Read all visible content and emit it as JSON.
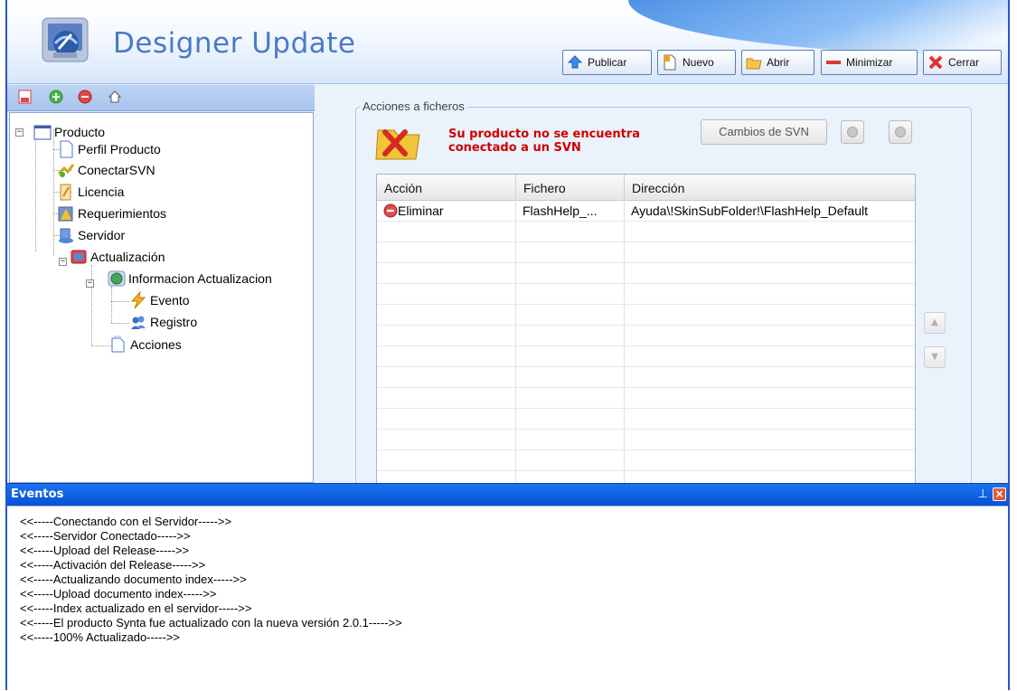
{
  "app": {
    "title": "Designer Update"
  },
  "toolbar": {
    "buttons": [
      {
        "label": "Publicar",
        "icon": "publish-icon"
      },
      {
        "label": "Nuevo",
        "icon": "new-document-icon"
      },
      {
        "label": "Abrir",
        "icon": "open-folder-icon"
      },
      {
        "label": "Minimizar",
        "icon": "minimize-icon"
      },
      {
        "label": "Cerrar",
        "icon": "close-x-icon"
      }
    ]
  },
  "tree": {
    "root": "Producto",
    "items": [
      "Perfil Producto",
      "ConectarSVN",
      "Licencia",
      "Requerimientos",
      "Servidor",
      "Actualización",
      "Informacion Actualizacion",
      "Evento",
      "Registro",
      "Acciones"
    ]
  },
  "main": {
    "group_title": "Acciones a ficheros",
    "warning": "Su producto no se encuentra conectado a un SVN",
    "svn_button": "Cambios de SVN",
    "columns": [
      "Acción",
      "Fichero",
      "Dirección"
    ],
    "rows": [
      {
        "accion": "Eliminar",
        "fichero": "FlashHelp_...",
        "direccion": "Ayuda\\!SkinSubFolder!\\FlashHelp_Default"
      }
    ]
  },
  "events": {
    "title": "Eventos",
    "lines": [
      "<<-----Conectando con el Servidor----->>",
      "<<-----Servidor Conectado----->>",
      "<<-----Upload del Release----->>",
      "<<-----Activación del Release----->>",
      "<<-----Actualizando documento index----->>",
      "<<-----Upload documento index----->>",
      "<<-----Index actualizado en el servidor----->>",
      "<<-----El producto Synta fue actualizado con la nueva versión 2.0.1----->>",
      "<<-----100% Actualizado----->>"
    ]
  },
  "colors": {
    "accent": "#0b5ee0",
    "warning_text": "#d00000",
    "title_blue": "#4a79c7"
  }
}
